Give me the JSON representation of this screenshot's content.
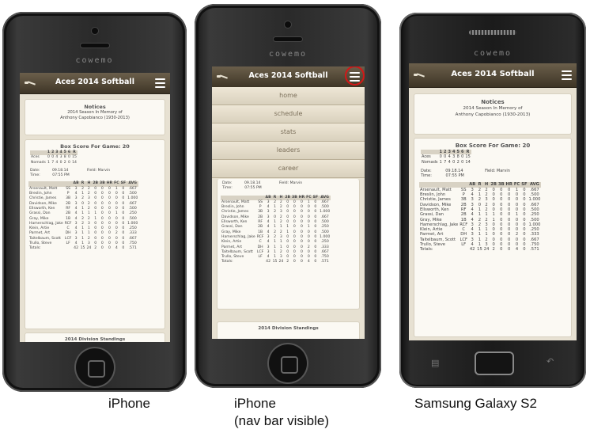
{
  "logo": "cowemo",
  "app": {
    "title": "Aces 2014 Softball",
    "notices_title": "Notices",
    "notices_line1": "2014 Season In Memory of",
    "notices_line2": "Anthony Capobianco (1930-2013)",
    "box_title": "Box Score For Game: 20",
    "innings_header": [
      "",
      "1",
      "2",
      "3",
      "4",
      "5",
      "6",
      "R"
    ],
    "innings": [
      [
        "Aces",
        "0",
        "0",
        "4",
        "3",
        "8",
        "0",
        "15"
      ],
      [
        "Nomads",
        "1",
        "7",
        "4",
        "0",
        "2",
        "0",
        "14"
      ]
    ],
    "date_label": "Date:",
    "date_value": "09.18.14",
    "field_label": "Field:",
    "field_value": "Marvin",
    "time_label": "Time:",
    "time_value": "07:55 PM",
    "stats_header": [
      "",
      "",
      "AB",
      "R",
      "H",
      "2B",
      "3B",
      "HR",
      "FC",
      "SF",
      "AVG"
    ],
    "players": [
      [
        "Arsenault, Matt",
        "SS",
        "3",
        "2",
        "2",
        "0",
        "0",
        "0",
        "1",
        "0",
        ".667"
      ],
      [
        "Breslin, John",
        "P",
        "4",
        "1",
        "2",
        "0",
        "0",
        "0",
        "0",
        "0",
        ".500"
      ],
      [
        "Christie, James",
        "3B",
        "3",
        "2",
        "3",
        "0",
        "0",
        "0",
        "0",
        "0",
        "1.000"
      ],
      [
        "Davidson, Mike",
        "2B",
        "3",
        "0",
        "2",
        "0",
        "0",
        "0",
        "0",
        "0",
        ".667"
      ],
      [
        "Ellsworth, Ken",
        "RF",
        "4",
        "1",
        "2",
        "0",
        "0",
        "0",
        "0",
        "0",
        ".500"
      ],
      [
        "Grassi, Dan",
        "2B",
        "4",
        "1",
        "1",
        "1",
        "0",
        "0",
        "1",
        "0",
        ".250"
      ],
      [
        "Gray, Mike",
        "1B",
        "4",
        "2",
        "2",
        "1",
        "0",
        "0",
        "0",
        "0",
        ".500"
      ],
      [
        "Hamerschlag, Jake",
        "RCF",
        "3",
        "2",
        "3",
        "0",
        "0",
        "0",
        "0",
        "0",
        "1.000"
      ],
      [
        "Klein, Artie",
        "C",
        "4",
        "1",
        "1",
        "0",
        "0",
        "0",
        "0",
        "0",
        ".250"
      ],
      [
        "Parmet, Art",
        "DH",
        "3",
        "1",
        "1",
        "0",
        "0",
        "0",
        "2",
        "0",
        ".333"
      ],
      [
        "Taitelbaum, Scott",
        "LCF",
        "3",
        "1",
        "2",
        "0",
        "0",
        "0",
        "0",
        "0",
        ".667"
      ],
      [
        "Trullo, Steve",
        "LF",
        "4",
        "1",
        "3",
        "0",
        "0",
        "0",
        "0",
        "0",
        ".750"
      ]
    ],
    "totals": [
      "Totals:",
      "",
      "42",
      "15",
      "24",
      "2",
      "0",
      "0",
      "4",
      "0",
      ".571"
    ],
    "standings_title": "2014 Division Standings",
    "nav_items": [
      "home",
      "schedule",
      "stats",
      "leaders",
      "career"
    ]
  },
  "captions": {
    "iphone": "iPhone",
    "iphone_nav_line1": "iPhone",
    "iphone_nav_line2": "(nav bar visible)",
    "galaxy": "Samsung Galaxy S2"
  }
}
